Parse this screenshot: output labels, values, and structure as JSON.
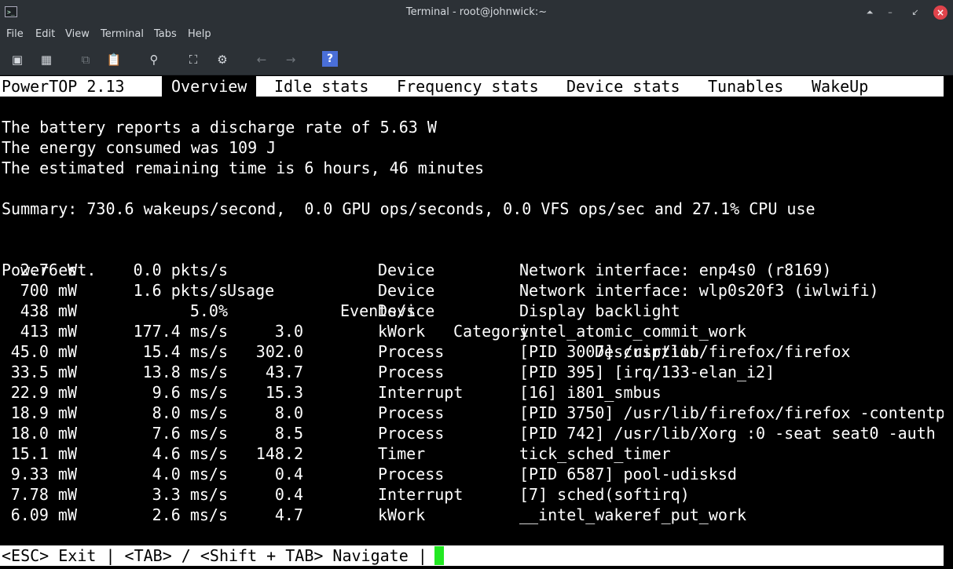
{
  "window": {
    "title": "Terminal - root@johnwick:~",
    "icon": "terminal-icon"
  },
  "menu": [
    "File",
    "Edit",
    "View",
    "Terminal",
    "Tabs",
    "Help"
  ],
  "toolbar": {
    "help_label": "?"
  },
  "powertop": {
    "version": "PowerTOP 2.13",
    "tabs": [
      "Overview",
      "Idle stats",
      "Frequency stats",
      "Device stats",
      "Tunables",
      "WakeUp"
    ],
    "battery_lines": [
      "The battery reports a discharge rate of 5.63 W",
      "The energy consumed was 109 J",
      "The estimated remaining time is 6 hours, 46 minutes"
    ],
    "summary": "Summary: 730.6 wakeups/second,  0.0 GPU ops/seconds, 0.0 VFS ops/sec and 27.1% CPU use",
    "headers": {
      "power": "Power est.",
      "usage": "Usage",
      "events": "Events/s",
      "category": "Category",
      "description": "Description"
    },
    "rows": [
      {
        "power": "2.76 W",
        "usage": "0.0 pkts/s",
        "events": "",
        "category": "Device",
        "description": "Network interface: enp4s0 (r8169)"
      },
      {
        "power": "700 mW",
        "usage": "1.6 pkts/s",
        "events": "",
        "category": "Device",
        "description": "Network interface: wlp0s20f3 (iwlwifi)"
      },
      {
        "power": "438 mW",
        "usage": "5.0%",
        "events": "",
        "category": "Device",
        "description": "Display backlight"
      },
      {
        "power": "413 mW",
        "usage": "177.4 ms/s",
        "events": "3.0",
        "category": "kWork",
        "description": "intel_atomic_commit_work"
      },
      {
        "power": "45.0 mW",
        "usage": "15.4 ms/s",
        "events": "302.0",
        "category": "Process",
        "description": "[PID 3007] /usr/lib/firefox/firefox"
      },
      {
        "power": "33.5 mW",
        "usage": "13.8 ms/s",
        "events": "43.7",
        "category": "Process",
        "description": "[PID 395] [irq/133-elan_i2]"
      },
      {
        "power": "22.9 mW",
        "usage": "9.6 ms/s",
        "events": "15.3",
        "category": "Interrupt",
        "description": "[16] i801_smbus"
      },
      {
        "power": "18.9 mW",
        "usage": "8.0 ms/s",
        "events": "8.0",
        "category": "Process",
        "description": "[PID 3750] /usr/lib/firefox/firefox -contentp"
      },
      {
        "power": "18.0 mW",
        "usage": "7.6 ms/s",
        "events": "8.5",
        "category": "Process",
        "description": "[PID 742] /usr/lib/Xorg :0 -seat seat0 -auth"
      },
      {
        "power": "15.1 mW",
        "usage": "4.6 ms/s",
        "events": "148.2",
        "category": "Timer",
        "description": "tick_sched_timer"
      },
      {
        "power": "9.33 mW",
        "usage": "4.0 ms/s",
        "events": "0.4",
        "category": "Process",
        "description": "[PID 6587] pool-udisksd"
      },
      {
        "power": "7.78 mW",
        "usage": "3.3 ms/s",
        "events": "0.4",
        "category": "Interrupt",
        "description": "[7] sched(softirq)"
      },
      {
        "power": "6.09 mW",
        "usage": "2.6 ms/s",
        "events": "4.7",
        "category": "kWork",
        "description": "__intel_wakeref_put_work"
      }
    ],
    "footer": "<ESC> Exit | <TAB> / <Shift + TAB> Navigate |"
  },
  "colors": {
    "chrome": "#2c3136",
    "cursor": "#22e822",
    "close": "#e0434b",
    "help": "#4a6fd8"
  }
}
